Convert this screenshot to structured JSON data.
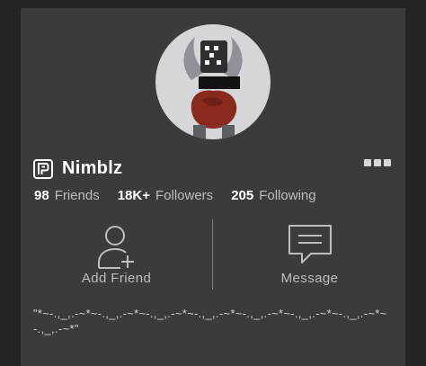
{
  "profile": {
    "username": "Nimblz",
    "has_premium": true,
    "avatar_icon": "avatar-headshot"
  },
  "stats": {
    "friends_count": "98",
    "friends_label": "Friends",
    "followers_count": "18K+",
    "followers_label": "Followers",
    "following_count": "205",
    "following_label": "Following"
  },
  "actions": {
    "add_friend_label": "Add Friend",
    "message_label": "Message"
  },
  "bio": "\"*~-.,_,.-~*~-.,_,.-~*~-.,_,.-~*~-.,_,.-~*~-.,_,.-~*~-.,_,.-~*~-.,_,.-~*~-.,_,.-~*\"",
  "colors": {
    "background": "#232427",
    "card": "#393b3d",
    "text_primary": "#ffffff",
    "text_secondary": "#bdbebe",
    "avatar_bg": "#d4d6da"
  }
}
